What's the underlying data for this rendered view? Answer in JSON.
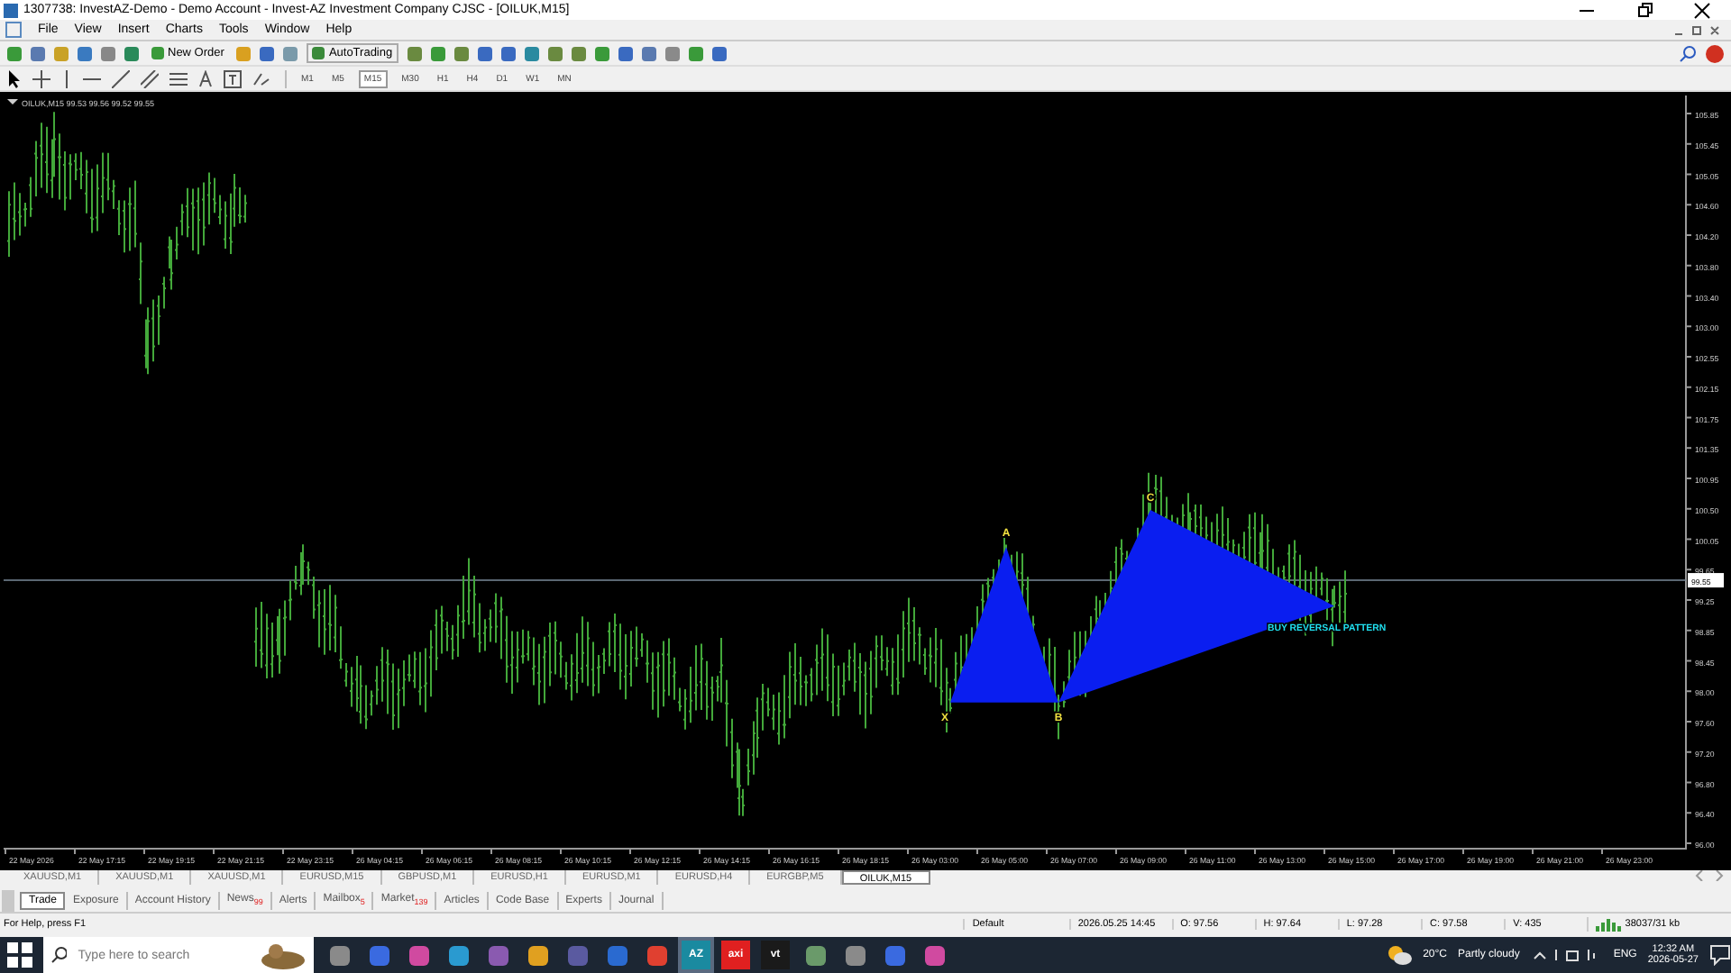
{
  "window": {
    "title": "1307738: InvestAZ-Demo - Demo Account - Invest-AZ Investment Company CJSC - [OILUK,M15]"
  },
  "menu": [
    "File",
    "View",
    "Insert",
    "Charts",
    "Tools",
    "Window",
    "Help"
  ],
  "toolbar": {
    "new_order": "New Order",
    "auto_trading": "AutoTrading",
    "timeframes": [
      {
        "label": "M1",
        "selected": false
      },
      {
        "label": "M5",
        "selected": false
      },
      {
        "label": "M15",
        "selected": true
      },
      {
        "label": "M30",
        "selected": false
      },
      {
        "label": "H1",
        "selected": false
      },
      {
        "label": "H4",
        "selected": false
      },
      {
        "label": "D1",
        "selected": false
      },
      {
        "label": "W1",
        "selected": false
      },
      {
        "label": "MN",
        "selected": false
      }
    ]
  },
  "chart": {
    "header": "OILUK,M15 99.53 99.56 99.52 99.55",
    "current_price": "99.55",
    "price_labels": [
      "105.85",
      "105.45",
      "105.05",
      "104.60",
      "104.20",
      "103.80",
      "103.40",
      "103.00",
      "102.55",
      "102.15",
      "101.75",
      "101.35",
      "100.95",
      "100.50",
      "100.05",
      "99.65",
      "99.25",
      "98.85",
      "98.45",
      "98.00",
      "97.60",
      "97.20",
      "96.80",
      "96.40",
      "96.00"
    ],
    "time_labels": [
      "22 May 2026",
      "22 May 17:15",
      "22 May 19:15",
      "22 May 21:15",
      "22 May 23:15",
      "26 May 04:15",
      "26 May 06:15",
      "26 May 08:15",
      "26 May 10:15",
      "26 May 12:15",
      "26 May 14:15",
      "26 May 16:15",
      "26 May 18:15",
      "26 May 03:00",
      "26 May 05:00",
      "26 May 07:00",
      "26 May 09:00",
      "26 May 11:00",
      "26 May 13:00",
      "26 May 15:00",
      "26 May 17:00",
      "26 May 19:00",
      "26 May 21:00",
      "26 May 23:00"
    ],
    "pattern_points": [
      "X",
      "A",
      "B",
      "C"
    ],
    "pattern_label": "BUY REVERSAL PATTERN"
  },
  "chart_tabs": [
    {
      "label": "XAUUSD,M1",
      "selected": false
    },
    {
      "label": "XAUUSD,M1",
      "selected": false
    },
    {
      "label": "XAUUSD,M1",
      "selected": false
    },
    {
      "label": "EURUSD,M15",
      "selected": false
    },
    {
      "label": "GBPUSD,M1",
      "selected": false
    },
    {
      "label": "EURUSD,H1",
      "selected": false
    },
    {
      "label": "EURUSD,M1",
      "selected": false
    },
    {
      "label": "EURUSD,H4",
      "selected": false
    },
    {
      "label": "EURGBP,M5",
      "selected": false
    },
    {
      "label": "OILUK,M15",
      "selected": true
    }
  ],
  "terminal_tabs": [
    {
      "label": "Trade",
      "selected": true
    },
    {
      "label": "Exposure",
      "selected": false
    },
    {
      "label": "Account History",
      "selected": false
    },
    {
      "label": "News",
      "badge": "99",
      "selected": false
    },
    {
      "label": "Alerts",
      "selected": false
    },
    {
      "label": "Mailbox",
      "badge": "5",
      "selected": false
    },
    {
      "label": "Market",
      "badge": "139",
      "selected": false
    },
    {
      "label": "Articles",
      "selected": false
    },
    {
      "label": "Code Base",
      "selected": false
    },
    {
      "label": "Experts",
      "selected": false
    },
    {
      "label": "Journal",
      "selected": false
    }
  ],
  "status_bar": {
    "help": "For Help, press F1",
    "profile": "Default",
    "time": "2026.05.25 14:45",
    "open": "O: 97.56",
    "high": "H: 97.64",
    "low": "L: 97.28",
    "close": "C: 97.58",
    "volume": "V: 435",
    "traffic": "38037/31 kb"
  },
  "taskbar": {
    "search_placeholder": "Type here to search",
    "apps": [
      {
        "kind": "icon"
      },
      {
        "kind": "icon"
      },
      {
        "kind": "icon"
      },
      {
        "kind": "icon"
      },
      {
        "kind": "icon"
      },
      {
        "kind": "icon"
      },
      {
        "kind": "icon"
      },
      {
        "kind": "icon"
      },
      {
        "kind": "icon"
      },
      {
        "kind": "text",
        "label": "AZ",
        "selected": true
      },
      {
        "kind": "text",
        "label": "axi",
        "selected": false
      },
      {
        "kind": "text",
        "label": "vt",
        "selected": false
      },
      {
        "kind": "icon"
      },
      {
        "kind": "icon"
      },
      {
        "kind": "icon"
      },
      {
        "kind": "icon"
      }
    ],
    "weather": "20°C",
    "weather_text": "Partly cloudy",
    "language": "ENG",
    "clock": "12:32 AM",
    "date": "2026-05-27"
  }
}
